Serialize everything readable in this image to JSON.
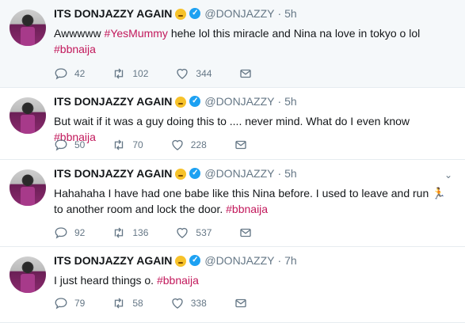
{
  "tweets": [
    {
      "name": "ITS DONJAZZY AGAIN",
      "handle": "@DONJAZZY",
      "sep": "·",
      "time": "5h",
      "text_parts": [
        "Awwwww ",
        "#YesMummy",
        " hehe lol this miracle and Nina na love in tokyo o lol ",
        "#bbnaija",
        ""
      ],
      "replies": "42",
      "retweets": "102",
      "likes": "344"
    },
    {
      "name": "ITS DONJAZZY AGAIN",
      "handle": "@DONJAZZY",
      "sep": "·",
      "time": "5h",
      "text_parts": [
        "But wait if it was a guy doing this to .... never mind. What do I even know ",
        "#bbnaija",
        "",
        "",
        ""
      ],
      "replies": "50",
      "retweets": "70",
      "likes": "228"
    },
    {
      "name": "ITS DONJAZZY AGAIN",
      "handle": "@DONJAZZY",
      "sep": "·",
      "time": "5h",
      "text_parts": [
        "Hahahaha I have had one babe like this Nina before. I used to leave and run 🏃 to another room and lock the door. ",
        "#bbnaija",
        "",
        "",
        ""
      ],
      "replies": "92",
      "retweets": "136",
      "likes": "537"
    },
    {
      "name": "ITS DONJAZZY AGAIN",
      "handle": "@DONJAZZY",
      "sep": "·",
      "time": "7h",
      "text_parts": [
        "I just heard things o. ",
        "#bbnaija",
        "",
        "",
        ""
      ],
      "replies": "79",
      "retweets": "58",
      "likes": "338"
    }
  ],
  "icons": {
    "reply": "reply-icon",
    "retweet": "retweet-icon",
    "like": "heart-icon",
    "dm": "envelope-icon",
    "verified": "verified-badge-icon",
    "emoji": "winking-face-icon",
    "caret": "chevron-down-icon"
  },
  "colors": {
    "hashtag": "#c2185b",
    "muted": "#657786",
    "verified": "#1da1f2",
    "highlight_bg": "#f5f8fa"
  }
}
